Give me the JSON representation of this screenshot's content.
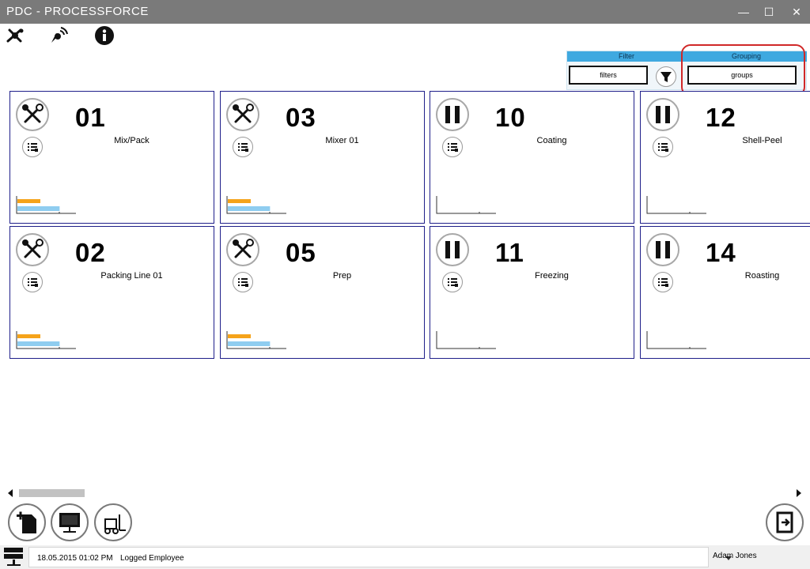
{
  "window": {
    "title": "PDC - PROCESSFORCE",
    "minimize_glyph": "—",
    "maximize_glyph": "☐",
    "close_glyph": "✕"
  },
  "toolbar": {
    "icons": [
      "production-icon",
      "signal-icon",
      "info-icon"
    ]
  },
  "filter_panel": {
    "filter_header": "Filter",
    "filter_value": "filters",
    "grouping_header": "Grouping",
    "grouping_value": "groups",
    "accent_color": "#3fa9e0",
    "highlight_color": "#d02828"
  },
  "tiles": [
    {
      "number": "01",
      "name": "Mix/Pack",
      "status": "maintenance",
      "bar_orange": 0.5,
      "bar_blue": 0.92
    },
    {
      "number": "03",
      "name": "Mixer 01",
      "status": "maintenance",
      "bar_orange": 0.5,
      "bar_blue": 0.92
    },
    {
      "number": "10",
      "name": "Coating",
      "status": "paused",
      "bar_orange": 0,
      "bar_blue": 0
    },
    {
      "number": "12",
      "name": "Shell-Peel",
      "status": "paused",
      "bar_orange": 0,
      "bar_blue": 0
    },
    {
      "number": "02",
      "name": "Packing Line 01",
      "status": "maintenance",
      "bar_orange": 0.5,
      "bar_blue": 0.92
    },
    {
      "number": "05",
      "name": "Prep",
      "status": "maintenance",
      "bar_orange": 0.5,
      "bar_blue": 0.92
    },
    {
      "number": "11",
      "name": "Freezing",
      "status": "paused",
      "bar_orange": 0,
      "bar_blue": 0
    },
    {
      "number": "14",
      "name": "Roasting",
      "status": "paused",
      "bar_orange": 0,
      "bar_blue": 0
    }
  ],
  "colors": {
    "tile_border": "#1f1f8a",
    "bar_orange": "#f5a31a",
    "bar_blue": "#8fcdf0"
  },
  "bottom_buttons": [
    "new-document-icon",
    "monitor-icon",
    "forklift-icon",
    "exit-icon"
  ],
  "statusbar": {
    "datetime": "18.05.2015 01:02 PM",
    "employee_label": "Logged Employee",
    "employee_name": "Adam Jones"
  }
}
